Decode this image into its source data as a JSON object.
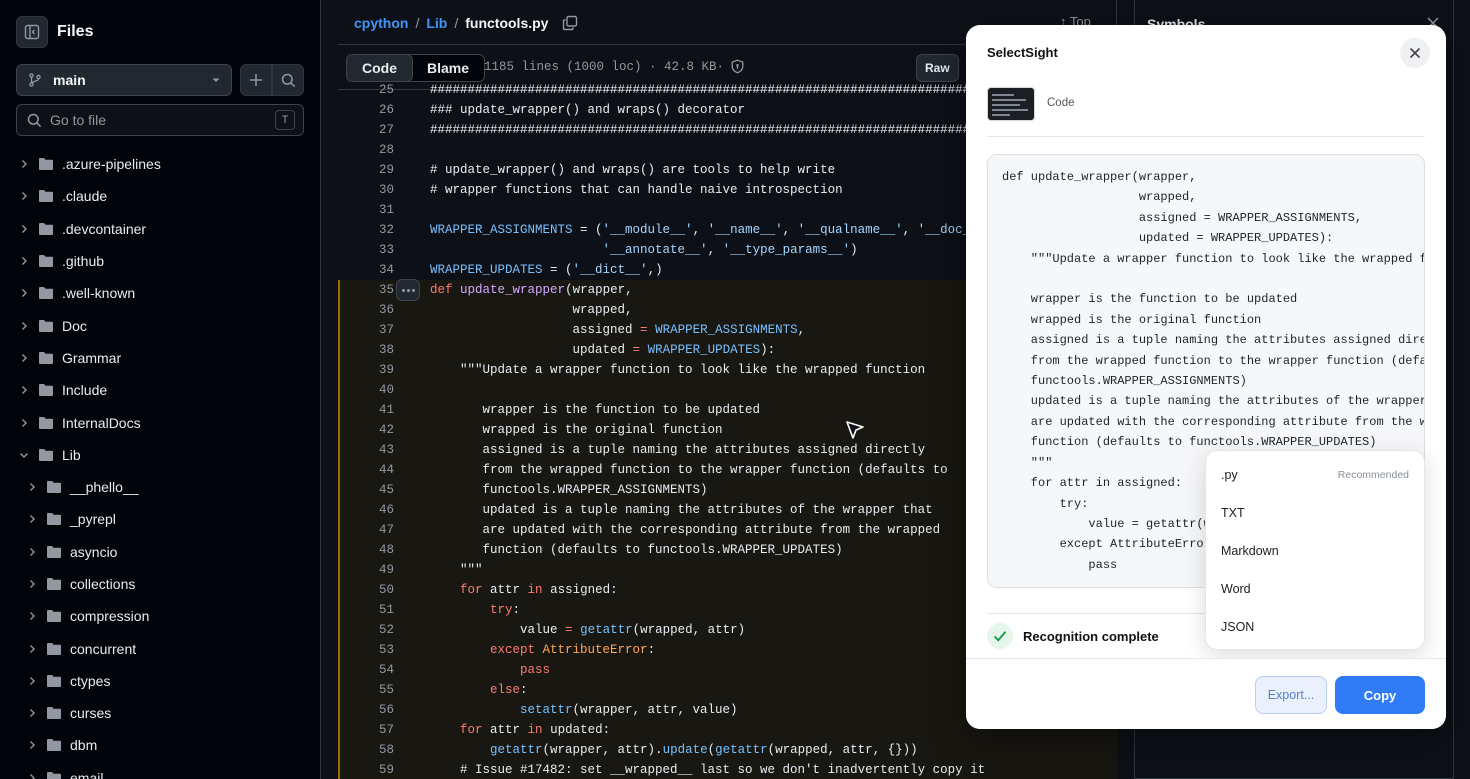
{
  "sidebar": {
    "title": "Files",
    "branch": "main",
    "goto_placeholder": "Go to file",
    "goto_shortcut": "T",
    "items": [
      {
        "label": ".azure-pipelines",
        "depth": 0,
        "expanded": false
      },
      {
        "label": ".claude",
        "depth": 0,
        "expanded": false
      },
      {
        "label": ".devcontainer",
        "depth": 0,
        "expanded": false
      },
      {
        "label": ".github",
        "depth": 0,
        "expanded": false
      },
      {
        "label": ".well-known",
        "depth": 0,
        "expanded": false
      },
      {
        "label": "Doc",
        "depth": 0,
        "expanded": false
      },
      {
        "label": "Grammar",
        "depth": 0,
        "expanded": false
      },
      {
        "label": "Include",
        "depth": 0,
        "expanded": false
      },
      {
        "label": "InternalDocs",
        "depth": 0,
        "expanded": false
      },
      {
        "label": "Lib",
        "depth": 0,
        "expanded": true
      },
      {
        "label": "__phello__",
        "depth": 1,
        "expanded": false
      },
      {
        "label": "_pyrepl",
        "depth": 1,
        "expanded": false
      },
      {
        "label": "asyncio",
        "depth": 1,
        "expanded": false
      },
      {
        "label": "collections",
        "depth": 1,
        "expanded": false
      },
      {
        "label": "compression",
        "depth": 1,
        "expanded": false
      },
      {
        "label": "concurrent",
        "depth": 1,
        "expanded": false
      },
      {
        "label": "ctypes",
        "depth": 1,
        "expanded": false
      },
      {
        "label": "curses",
        "depth": 1,
        "expanded": false
      },
      {
        "label": "dbm",
        "depth": 1,
        "expanded": false
      },
      {
        "label": "email",
        "depth": 1,
        "expanded": false
      }
    ]
  },
  "header": {
    "repo": "cpython",
    "dir": "Lib",
    "file": "functools.py",
    "top_label": "Top",
    "view_code": "Code",
    "view_blame": "Blame",
    "file_info": "1185 lines (1000 loc) · 42.8 KB·",
    "raw_label": "Raw"
  },
  "code": {
    "highlight_from": 35,
    "lines": [
      {
        "n": 25,
        "t": "############################################################################",
        "k": "cm"
      },
      {
        "n": 26,
        "t": "### update_wrapper() and wraps() decorator",
        "k": "cm"
      },
      {
        "n": 27,
        "t": "############################################################################",
        "k": "cm"
      },
      {
        "n": 28,
        "t": "",
        "k": ""
      },
      {
        "n": 29,
        "t": "# update_wrapper() and wraps() are tools to help write",
        "k": "cm"
      },
      {
        "n": 30,
        "t": "# wrapper functions that can handle naive introspection",
        "k": "cm"
      },
      {
        "n": 31,
        "t": "",
        "k": ""
      },
      {
        "n": 32,
        "t": "",
        "k": "assign1"
      },
      {
        "n": 33,
        "t": "",
        "k": "assign2"
      },
      {
        "n": 34,
        "t": "",
        "k": "assign3"
      },
      {
        "n": 35,
        "t": "",
        "k": "def"
      },
      {
        "n": 36,
        "t": "                   wrapped,",
        "k": ""
      },
      {
        "n": 37,
        "t": "",
        "k": "p1"
      },
      {
        "n": 38,
        "t": "",
        "k": "p2"
      },
      {
        "n": 39,
        "t": "    \"\"\"Update a wrapper function to look like the wrapped function",
        "k": "st"
      },
      {
        "n": 40,
        "t": "",
        "k": ""
      },
      {
        "n": 41,
        "t": "       wrapper is the function to be updated",
        "k": "st"
      },
      {
        "n": 42,
        "t": "       wrapped is the original function",
        "k": "st"
      },
      {
        "n": 43,
        "t": "       assigned is a tuple naming the attributes assigned directly",
        "k": "st"
      },
      {
        "n": 44,
        "t": "       from the wrapped function to the wrapper function (defaults to",
        "k": "st"
      },
      {
        "n": 45,
        "t": "       functools.WRAPPER_ASSIGNMENTS)",
        "k": "st"
      },
      {
        "n": 46,
        "t": "       updated is a tuple naming the attributes of the wrapper that",
        "k": "st"
      },
      {
        "n": 47,
        "t": "       are updated with the corresponding attribute from the wrapped",
        "k": "st"
      },
      {
        "n": 48,
        "t": "       function (defaults to functools.WRAPPER_UPDATES)",
        "k": "st"
      },
      {
        "n": 49,
        "t": "    \"\"\"",
        "k": "st"
      },
      {
        "n": 50,
        "t": "",
        "k": "for1"
      },
      {
        "n": 51,
        "t": "",
        "k": "try"
      },
      {
        "n": 52,
        "t": "",
        "k": "val"
      },
      {
        "n": 53,
        "t": "",
        "k": "exc"
      },
      {
        "n": 54,
        "t": "",
        "k": "pass"
      },
      {
        "n": 55,
        "t": "",
        "k": "else"
      },
      {
        "n": 56,
        "t": "",
        "k": "set"
      },
      {
        "n": 57,
        "t": "",
        "k": "for2"
      },
      {
        "n": 58,
        "t": "",
        "k": "upd"
      },
      {
        "n": 59,
        "t": "    # Issue #17482: set __wrapped__ last so we don't inadvertently copy it",
        "k": "cm"
      }
    ]
  },
  "symbols": {
    "title": "Symbols"
  },
  "modal": {
    "title": "SelectSight",
    "type_label": "Code",
    "recognized_text": "def update_wrapper(wrapper,\n                   wrapped,\n                   assigned = WRAPPER_ASSIGNMENTS,\n                   updated = WRAPPER_UPDATES):\n    \"\"\"Update a wrapper function to look like the wrapped function\n\n    wrapper is the function to be updated\n    wrapped is the original function\n    assigned is a tuple naming the attributes assigned directly\n    from the wrapped function to the wrapper function (defaults to\n    functools.WRAPPER_ASSIGNMENTS)\n    updated is a tuple naming the attributes of the wrapper that\n    are updated with the corresponding attribute from the wrapped\n    function (defaults to functools.WRAPPER_UPDATES)\n    \"\"\"\n    for attr in assigned:\n        try:\n            value = getattr(wrapped, attr)\n        except AttributeError:\n            pass",
    "status": "Recognition complete",
    "export_label": "Export...",
    "copy_label": "Copy",
    "export_menu": [
      {
        "label": ".py",
        "tag": "Recommended"
      },
      {
        "label": "TXT",
        "tag": ""
      },
      {
        "label": "Markdown",
        "tag": ""
      },
      {
        "label": "Word",
        "tag": ""
      },
      {
        "label": "JSON",
        "tag": ""
      }
    ]
  },
  "colors": {
    "accent": "#4493f8",
    "copy_button": "#2f7cf6",
    "success": "#1f9d55",
    "highlight_bar": "#9e6a03"
  }
}
